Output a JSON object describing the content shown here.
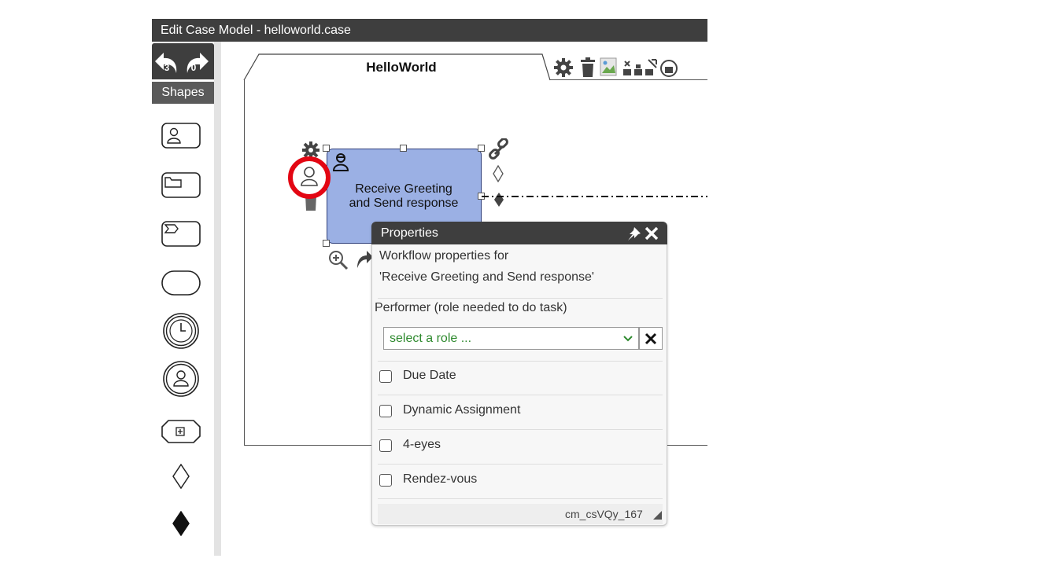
{
  "window": {
    "title": "Edit Case Model - helloworld.case"
  },
  "toolbar": {
    "undo_count": "3",
    "redo_count": "0"
  },
  "shapes_panel": {
    "header": "Shapes",
    "items": [
      "human-task-icon",
      "case-task-icon",
      "process-task-icon",
      "stage-icon",
      "timer-event-icon",
      "user-event-icon",
      "case-file-item-icon",
      "entry-criterion-icon",
      "exit-criterion-icon"
    ]
  },
  "canvas": {
    "tab_title": "HelloWorld",
    "task": {
      "label_line1": "Receive Greeting",
      "label_line2": "and Send response"
    }
  },
  "properties": {
    "title": "Properties",
    "subtitle_line1": "Workflow properties for",
    "subtitle_line2": "'Receive Greeting and Send response'",
    "performer_label": "Performer (role needed to do task)",
    "role_placeholder": "select a role ...",
    "options": [
      "Due Date",
      "Dynamic Assignment",
      "4-eyes",
      "Rendez-vous"
    ],
    "element_id": "cm_csVQy_167"
  },
  "colors": {
    "titlebar": "#3e3e3e",
    "task_fill": "#9bb0e4",
    "highlight_ring": "#e30613",
    "select_text": "#2f8a2f"
  }
}
